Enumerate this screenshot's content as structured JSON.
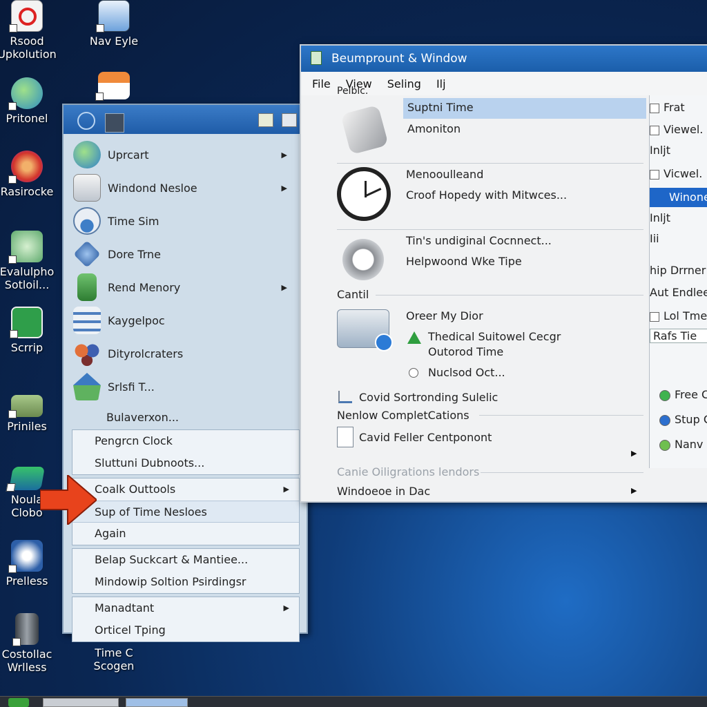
{
  "desktop": {
    "icons_left": [
      {
        "label": "Rsood\nUpkolution",
        "icon": "no-entry-icon"
      },
      {
        "label": "Pritonel",
        "icon": "globe-icon"
      },
      {
        "label": "Rasirocke",
        "icon": "media-disc-icon"
      },
      {
        "label": "Evalulpho\nSotloil...",
        "icon": "network-icon"
      },
      {
        "label": "Scrrip",
        "icon": "spreadsheet-icon"
      },
      {
        "label": "Priniles",
        "icon": "printer-icon"
      },
      {
        "label": "Noula\nClobo",
        "icon": "monitor-icon"
      },
      {
        "label": "Prelless",
        "icon": "shield-icon"
      },
      {
        "label": "Costollac\nWrlless",
        "icon": "server-icon"
      }
    ],
    "icons_second": [
      {
        "label": "Nav Eyle",
        "icon": "window-icon"
      },
      {
        "label": "",
        "icon": "home-icon"
      },
      {
        "label": "Time C\nScogen",
        "icon": "clock-icon"
      }
    ]
  },
  "start_menu": {
    "items": [
      {
        "label": "Uprcart",
        "icon": "globe-icon",
        "has_submenu": true
      },
      {
        "label": "Windond Nesloe",
        "icon": "mail-icon",
        "has_submenu": true
      },
      {
        "label": "Time Sim",
        "icon": "gauge-icon",
        "has_submenu": false
      },
      {
        "label": "Dore Trne",
        "icon": "network-icon",
        "has_submenu": false
      },
      {
        "label": "Rend Menory",
        "icon": "memory-icon",
        "has_submenu": true
      },
      {
        "label": "Kaygelpoc",
        "icon": "drives-icon",
        "has_submenu": false
      },
      {
        "label": "Dityrolcraters",
        "icon": "butterfly-icon",
        "has_submenu": false
      },
      {
        "label": "Srlsfi T...",
        "icon": "home-icon",
        "has_submenu": false
      },
      {
        "label": "Bulaverxon...",
        "icon": "",
        "has_submenu": false
      }
    ],
    "groups": [
      [
        {
          "label": "Pengrcn Clock"
        },
        {
          "label": "Sluttuni Dubnoots..."
        }
      ],
      [
        {
          "label": "Coalk Outtools",
          "has_submenu": true
        },
        {
          "label": "Sup of Time Nesloes",
          "selected": true
        },
        {
          "label": "Again"
        }
      ],
      [
        {
          "label": "Belap Suckcart & Mantiee..."
        },
        {
          "label": "Mindowip Soltion Psirdingsr"
        }
      ],
      [
        {
          "label": "Manadtant",
          "has_submenu": true
        },
        {
          "label": "Orticel Tping"
        }
      ]
    ]
  },
  "window": {
    "title": "Beumprount & Window",
    "menu": [
      "File",
      "View",
      "Seling",
      "Ilj"
    ],
    "menu_sub": "Pelblc.",
    "panel": {
      "entry1": {
        "title": "Suptni Time",
        "sub": "Amoniton"
      },
      "entry2": {
        "title": "Menooulleand",
        "sub": "Croof Hopedy with Mitwces..."
      },
      "entry3": {
        "title": "Tin's undiginal Cocnnect...",
        "sub": "Helpwoond Wke Tipe"
      },
      "section1": "Cantil",
      "entry4": {
        "title": "Oreer My Dior",
        "line1": "Thedical Suitowel Cecgr",
        "line2": "Outorod Time",
        "line3": "Nuclsod Oct..."
      },
      "line_a": "Covid Sortronding Sulelic",
      "line_b": "Nenlow CompletCations",
      "line_c": "Cavid Feller Centponont",
      "line_d": "Canie Oiligrations lendors",
      "line_e": "Windoeoe in Dac"
    }
  },
  "right_panel": {
    "rows": [
      {
        "label": "Frat",
        "type": "check"
      },
      {
        "label": "Viewel.",
        "type": "check"
      },
      {
        "label": "Inljt",
        "type": "text"
      },
      {
        "label": "Vicwel.",
        "type": "check"
      },
      {
        "label": "Winone",
        "type": "highlight"
      },
      {
        "label": "Inljt",
        "type": "text"
      },
      {
        "label": "Iii",
        "type": "text"
      },
      {
        "label": "hip Drrner",
        "type": "text"
      },
      {
        "label": "Aut Endlee",
        "type": "text"
      },
      {
        "label": "Lol Tme",
        "type": "check"
      },
      {
        "label": "Rafs Tie",
        "type": "field"
      },
      {
        "label": "Free C",
        "type": "radio-green"
      },
      {
        "label": "Stup C",
        "type": "radio-blue"
      },
      {
        "label": "Nanv",
        "type": "radio-green"
      }
    ]
  },
  "colors": {
    "accent": "#1f5ca8",
    "highlight": "#b9d2ee",
    "arrow": "#e8431c"
  }
}
